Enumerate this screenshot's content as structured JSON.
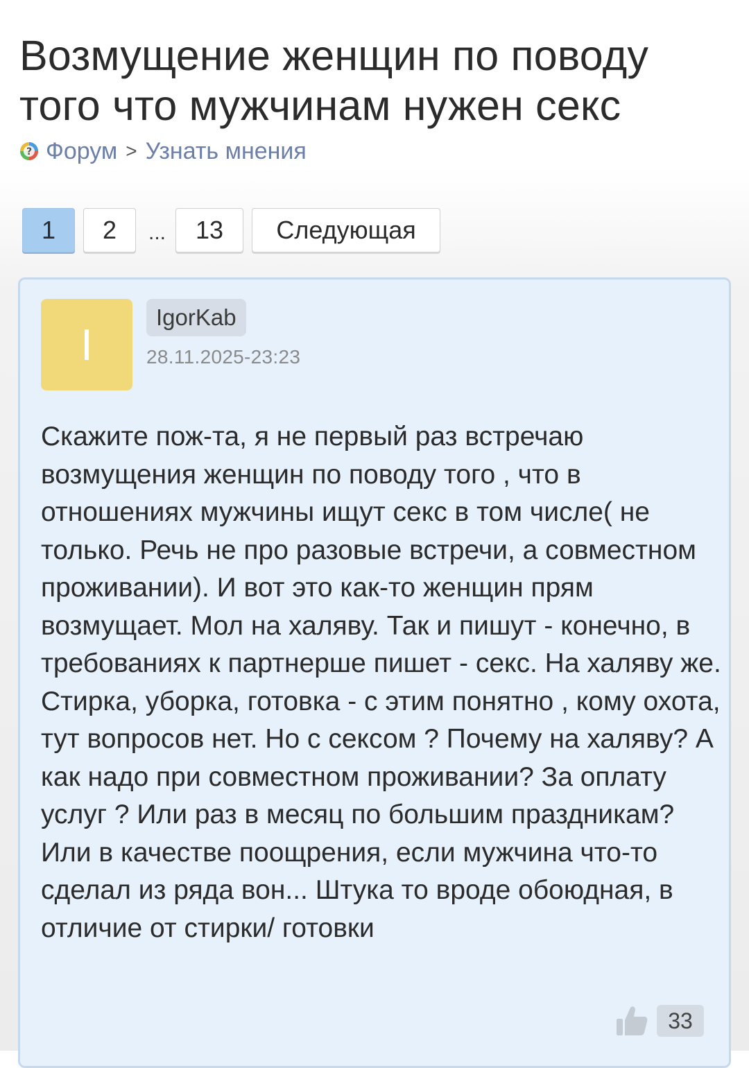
{
  "title": "Возмущение женщин по поводу того что мужчинам нужен секс",
  "breadcrumb": {
    "icon": "question-globe-icon",
    "items": [
      "Форум",
      "Узнать мнения"
    ],
    "separator": ">"
  },
  "pagination": {
    "pages": [
      "1",
      "2"
    ],
    "ellipsis": "...",
    "last": "13",
    "next_label": "Следующая",
    "active": "1"
  },
  "post": {
    "avatar_letter": "I",
    "avatar_color": "#f1d97a",
    "author": "IgorKab",
    "date": "28.11.2025-23:23",
    "text": "Скажите пож-та, я не первый раз встречаю возмущения женщин по поводу того , что в отношениях мужчины ищут секс в том числе( не только. Речь не про разовые встречи, а совместном проживании). И вот это как-то женщин прям возмущает. Мол на халяву. Так и пишут - конечно, в требованиях к партнерше пишет - секс. На халяву же. Стирка, уборка, готовка - с этим понятно , кому охота, тут вопросов нет. Но с сексом ? Почему на халяву? А как надо при совместном проживании? За оплату услуг ? Или раз в месяц по большим праздникам? Или в качестве поощрения, если мужчина что-то сделал из ряда вон... Штука то вроде обоюдная, в отличие от стирки/ готовки",
    "likes": "33",
    "like_icon": "thumbs-up-icon"
  },
  "colors": {
    "link": "#6b7fa8",
    "active_page": "#a6cdef",
    "post_bg": "#e7f1fb",
    "post_border": "#c6d9ec"
  }
}
